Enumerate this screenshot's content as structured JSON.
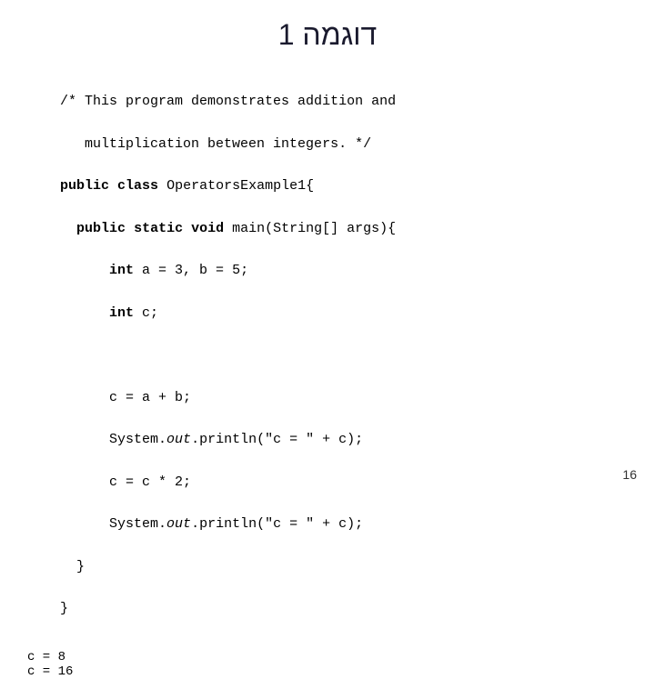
{
  "slide": {
    "title": "דוגמה 1",
    "page_number": "16",
    "code": {
      "comment_line1": "/* This program demonstrates addition and",
      "comment_line2": "   multiplication between integers. */",
      "class_decl": "public class OperatorsExample1{",
      "method_decl": "  public static void main(String[] args){",
      "var_a": "      int a = 3, b = 5;",
      "var_c": "      int c;",
      "blank1": "",
      "assign_c": "      c = a + b;",
      "println1": "      System.out.println(\"c = \" + c);",
      "multiply": "      c = c * 2;",
      "println2": "      System.out.println(\"c = \" + c);",
      "close1": "  }",
      "close2": "}"
    },
    "output": {
      "line1": "  c = 8",
      "line2": "  c = 16"
    }
  }
}
